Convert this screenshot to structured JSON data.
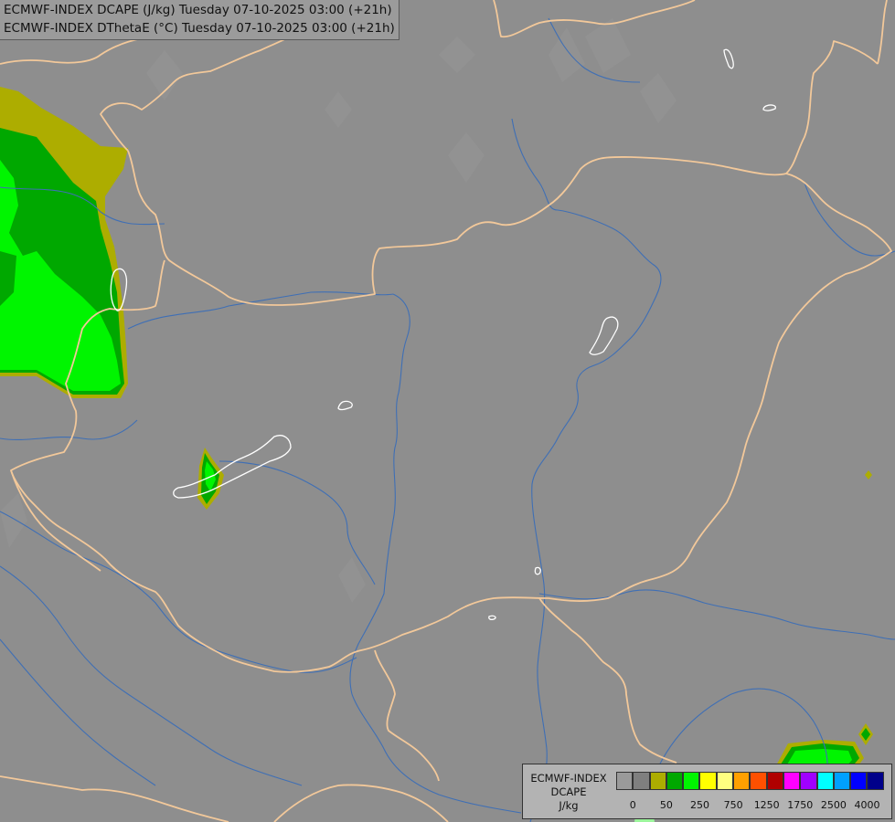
{
  "header": {
    "line1": "ECMWF-INDEX DCAPE (J/kg) Tuesday 07-10-2025 03:00 (+21h)",
    "line2": "ECMWF-INDEX DThetaE (°C) Tuesday 07-10-2025 03:00 (+21h)"
  },
  "legend": {
    "title_line1": "ECMWF-INDEX",
    "title_line2": "DCAPE",
    "title_line3": "J/kg",
    "colors": [
      "#9a9a9a",
      "#7f7f7f",
      "#adad00",
      "#00a800",
      "#00f500",
      "#ffff00",
      "#ffff80",
      "#ffa000",
      "#ff5000",
      "#b00000",
      "#ff00ff",
      "#a000ff",
      "#00ffff",
      "#00a0ff",
      "#0000ff",
      "#00008a"
    ],
    "tick_labels": [
      {
        "label": "0",
        "index": 1
      },
      {
        "label": "50",
        "index": 3
      },
      {
        "label": "250",
        "index": 5
      },
      {
        "label": "750",
        "index": 7
      },
      {
        "label": "1250",
        "index": 9
      },
      {
        "label": "1750",
        "index": 11
      },
      {
        "label": "2500",
        "index": 13
      },
      {
        "label": "4000",
        "index": 15
      }
    ]
  },
  "map": {
    "background_color": "#8e8e8e",
    "border_color": "#f2c89a",
    "river_color": "#3f6fb5",
    "lake_color": "#ffffff"
  }
}
